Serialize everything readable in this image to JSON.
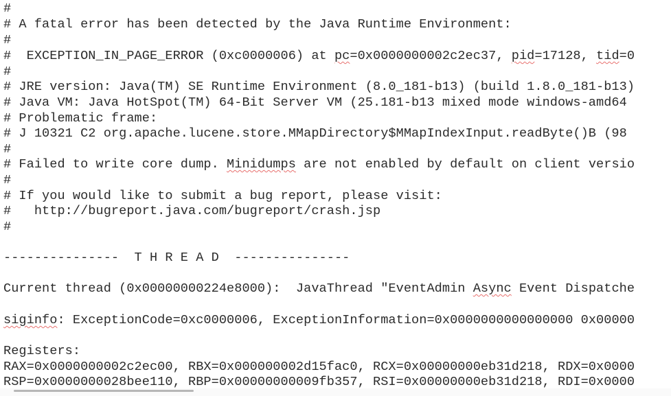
{
  "document": {
    "lines": [
      {
        "id": "l01",
        "segments": [
          {
            "text": "#"
          }
        ]
      },
      {
        "id": "l02",
        "segments": [
          {
            "text": "# A fatal error has been detected by the Java Runtime Environment:"
          }
        ]
      },
      {
        "id": "l03",
        "segments": [
          {
            "text": "#"
          }
        ]
      },
      {
        "id": "l04",
        "segments": [
          {
            "text": "#  EXCEPTION_IN_PAGE_ERROR (0xc0000006) at "
          },
          {
            "text": "pc",
            "flag": "spell"
          },
          {
            "text": "=0x0000000002c2ec37, "
          },
          {
            "text": "pid",
            "flag": "spell"
          },
          {
            "text": "=17128, "
          },
          {
            "text": "tid",
            "flag": "spell"
          },
          {
            "text": "=0"
          }
        ]
      },
      {
        "id": "l05",
        "segments": [
          {
            "text": "#"
          }
        ]
      },
      {
        "id": "l06",
        "segments": [
          {
            "text": "# JRE version: Java(TM) SE Runtime Environment (8.0_181-b13) (build 1.8.0_181-b13)"
          }
        ]
      },
      {
        "id": "l07",
        "segments": [
          {
            "text": "# Java VM: Java HotSpot(TM) 64-Bit Server VM (25.181-b13 mixed mode windows-amd64"
          }
        ]
      },
      {
        "id": "l08",
        "segments": [
          {
            "text": "# Problematic frame:"
          }
        ]
      },
      {
        "id": "l09",
        "segments": [
          {
            "text": "# J 10321 C2 org.apache.lucene.store.MMapDirectory$MMapIndexInput.readByte()B (98"
          }
        ]
      },
      {
        "id": "l10",
        "segments": [
          {
            "text": "#"
          }
        ]
      },
      {
        "id": "l11",
        "segments": [
          {
            "text": "# Failed to write core dump. "
          },
          {
            "text": "Minidumps",
            "flag": "spell"
          },
          {
            "text": " are not enabled by default on client versio"
          }
        ]
      },
      {
        "id": "l12",
        "segments": [
          {
            "text": "#"
          }
        ]
      },
      {
        "id": "l13",
        "segments": [
          {
            "text": "# If you would like to submit a bug report, please visit:"
          }
        ]
      },
      {
        "id": "l14",
        "segments": [
          {
            "text": "#   http://bugreport.java.com/bugreport/crash.jsp"
          }
        ]
      },
      {
        "id": "l15",
        "segments": [
          {
            "text": "#"
          }
        ]
      },
      {
        "id": "l16",
        "segments": [
          {
            "text": ""
          }
        ]
      },
      {
        "id": "l17",
        "segments": [
          {
            "text": "---------------  T H R E A D  ---------------"
          }
        ]
      },
      {
        "id": "l18",
        "segments": [
          {
            "text": ""
          }
        ]
      },
      {
        "id": "l19",
        "segments": [
          {
            "text": "Current thread (0x00000000224e8000):  JavaThread \"EventAdmin "
          },
          {
            "text": "Async",
            "flag": "spell"
          },
          {
            "text": " Event Dispatche"
          }
        ]
      },
      {
        "id": "l20",
        "segments": [
          {
            "text": ""
          }
        ]
      },
      {
        "id": "l21",
        "segments": [
          {
            "text": "siginfo",
            "flag": "spell"
          },
          {
            "text": ": ExceptionCode=0xc0000006, ExceptionInformation=0x0000000000000000 0x00000"
          }
        ]
      },
      {
        "id": "l22",
        "segments": [
          {
            "text": ""
          }
        ]
      },
      {
        "id": "l23",
        "segments": [
          {
            "text": "Registers:"
          }
        ]
      },
      {
        "id": "l24",
        "segments": [
          {
            "text": "RAX=0x0000000002c2ec00, RBX=0x000000002d15fac0, RCX=0x00000000eb31d218, RDX=0x0000"
          }
        ]
      },
      {
        "id": "l25",
        "segments": [
          {
            "text": "RSP=0x0000000028bee110, RBP=0x00000000009fb357, RSI=0x00000000eb31d218, RDI=0x0000"
          }
        ]
      }
    ]
  },
  "colors": {
    "text": "#2b2b2b",
    "background": "#ffffff",
    "spellcheck_underline": "#e8706e",
    "scrollbar": "#b7b7b7"
  }
}
